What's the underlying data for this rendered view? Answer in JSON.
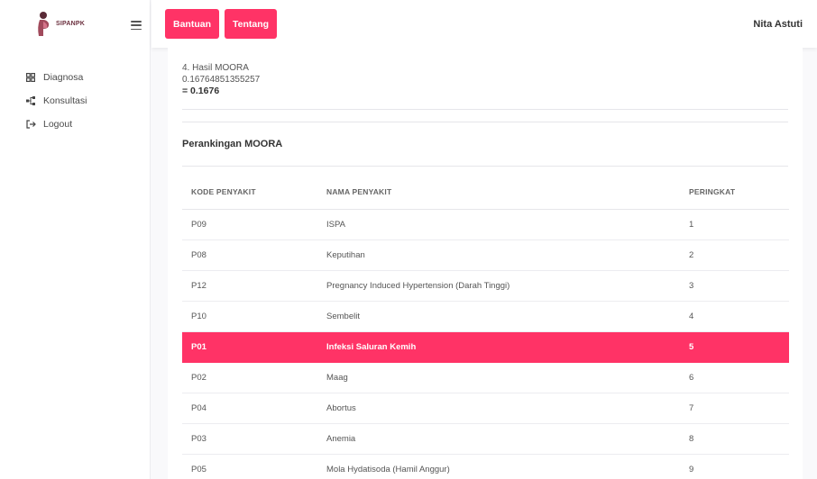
{
  "brand": {
    "name": "SIPANPK"
  },
  "sidebar": {
    "items": [
      {
        "label": "Diagnosa",
        "icon": "grid-icon"
      },
      {
        "label": "Konsultasi",
        "icon": "flow-icon"
      },
      {
        "label": "Logout",
        "icon": "logout-icon"
      }
    ]
  },
  "topbar": {
    "bantuan_label": "Bantuan",
    "tentang_label": "Tentang",
    "user_name": "Nita Astuti"
  },
  "hasil": {
    "heading": "4. Hasil MOORA",
    "raw_value": "0.16764851355257",
    "final_value": "= 0.1676"
  },
  "ranking": {
    "title": "Perankingan MOORA",
    "columns": [
      "KODE PENYAKIT",
      "NAMA PENYAKIT",
      "PERINGKAT"
    ],
    "rows": [
      {
        "kode": "P09",
        "nama": "ISPA",
        "peringkat": "1"
      },
      {
        "kode": "P08",
        "nama": "Keputihan",
        "peringkat": "2"
      },
      {
        "kode": "P12",
        "nama": "Pregnancy Induced Hypertension (Darah Tinggi)",
        "peringkat": "3"
      },
      {
        "kode": "P10",
        "nama": "Sembelit",
        "peringkat": "4"
      },
      {
        "kode": "P01",
        "nama": "Infeksi Saluran Kemih",
        "peringkat": "5"
      },
      {
        "kode": "P02",
        "nama": "Maag",
        "peringkat": "6"
      },
      {
        "kode": "P04",
        "nama": "Abortus",
        "peringkat": "7"
      },
      {
        "kode": "P03",
        "nama": "Anemia",
        "peringkat": "8"
      },
      {
        "kode": "P05",
        "nama": "Mola Hydatisoda (Hamil Anggur)",
        "peringkat": "9"
      }
    ],
    "highlighted_code": "P01"
  },
  "colors": {
    "accent": "#ff3366",
    "brand": "#6b2f3e"
  }
}
